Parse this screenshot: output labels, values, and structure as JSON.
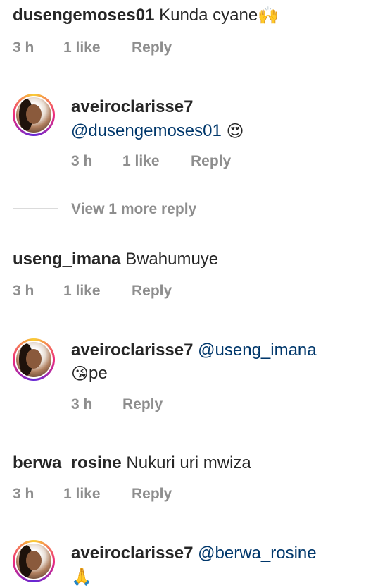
{
  "comments": [
    {
      "user": "dusengemoses01",
      "text": "Kunda cyane",
      "emoji": "🙌",
      "time": "3 h",
      "likes": "1 like",
      "reply": "Reply"
    },
    {
      "user": "aveiroclarisse7",
      "mention": "@dusengemoses01",
      "emoji": "😍",
      "time": "3 h",
      "likes": "1 like",
      "reply": "Reply"
    },
    {
      "view_more": "View 1 more reply"
    },
    {
      "user": "useng_imana",
      "text": "Bwahumuye",
      "time": "3 h",
      "likes": "1 like",
      "reply": "Reply"
    },
    {
      "user": "aveiroclarisse7",
      "mention": "@useng_imana",
      "emoji": "😘",
      "text2": "pe",
      "time": "3 h",
      "reply": "Reply"
    },
    {
      "user": "berwa_rosine",
      "text": "Nukuri uri mwiza",
      "time": "3 h",
      "likes": "1 like",
      "reply": "Reply"
    },
    {
      "user": "aveiroclarisse7",
      "mention": "@berwa_rosine",
      "emoji": "🙏"
    }
  ]
}
